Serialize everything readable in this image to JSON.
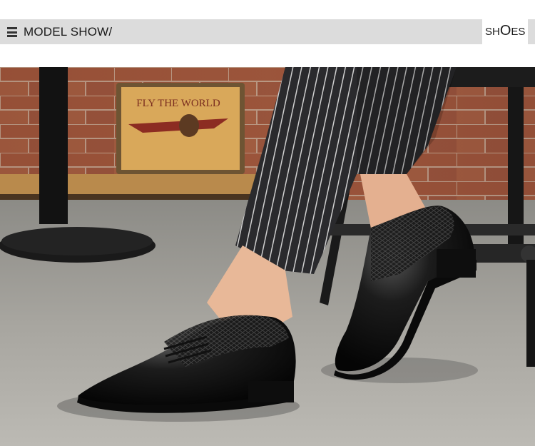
{
  "header": {
    "title": "MODEL SHOW/",
    "side_label_prefix": "SH",
    "side_label_big": "O",
    "side_label_suffix": "ES"
  },
  "photo": {
    "description_icon": "menu-icon"
  },
  "poster": {
    "text": "FLY THE WORLD"
  }
}
